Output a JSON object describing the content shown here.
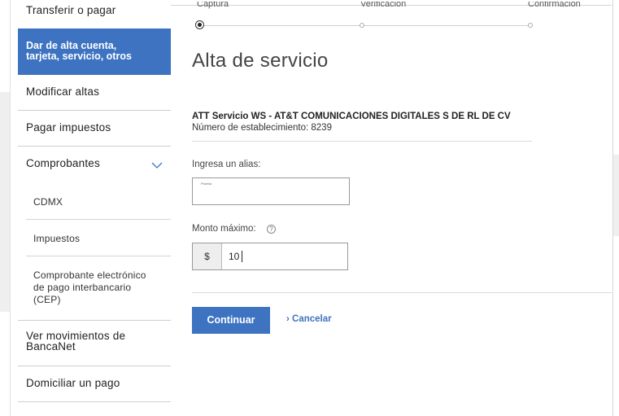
{
  "stepper": {
    "steps": [
      "Captura",
      "Verificación",
      "Confirmación"
    ]
  },
  "sidebar": {
    "items": [
      {
        "label": "Transferir o pagar"
      },
      {
        "label_line1": "Dar de alta cuenta,",
        "label_line2": "tarjeta, servicio, otros"
      },
      {
        "label": "Modificar altas"
      },
      {
        "label": "Pagar impuestos"
      },
      {
        "label": "Comprobantes"
      },
      {
        "label": "CDMX"
      },
      {
        "label": "Impuestos"
      },
      {
        "label_line1": "Comprobante electrónico",
        "label_line2": "de pago interbancario",
        "label_line3": "(CEP)"
      },
      {
        "label_line1": "Ver movimientos de",
        "label_line2": "BancaNet"
      },
      {
        "label": "Domiciliar un pago"
      }
    ]
  },
  "main": {
    "title": "Alta de servicio",
    "service_name": "ATT Servicio WS - AT&T COMUNICACIONES DIGITALES S DE RL DE CV",
    "establishment": "Número de establecimiento: 8239",
    "alias_label": "Ingresa un alias:",
    "alias_value": "Prueba",
    "max_amount_label": "Monto máximo:",
    "currency_symbol": "$",
    "max_amount_value": "10",
    "continue_label": "Continuar",
    "cancel_label": "› Cancelar"
  },
  "colors": {
    "accent": "#3d73c1"
  },
  "icons": {
    "help": "question-circle-icon",
    "expand": "chevron-down-icon"
  }
}
